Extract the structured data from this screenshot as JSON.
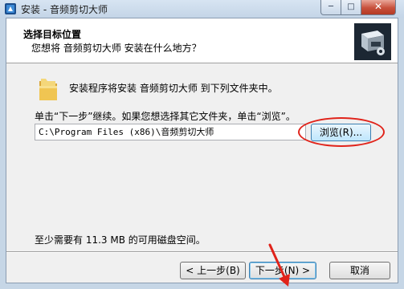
{
  "window": {
    "title": "安装 - 音频剪切大师",
    "minimize_label": "─",
    "maximize_label": "□",
    "close_label": "✕"
  },
  "header": {
    "title": "选择目标位置",
    "subtitle": "您想将 音频剪切大师 安装在什么地方？"
  },
  "body": {
    "destination_message": "安装程序将安装 音频剪切大师 到下列文件夹中。",
    "hint": "单击“下一步”继续。如果您想选择其它文件夹，单击“浏览”。",
    "path_value": "C:\\Program Files (x86)\\音频剪切大师",
    "browse_label": "浏览(R)...",
    "space_required": "至少需要有 11.3 MB 的可用磁盘空间。"
  },
  "footer": {
    "back_label": "< 上一步(B)",
    "next_label": "下一步(N) >",
    "cancel_label": "取消"
  },
  "colors": {
    "annotation": "#e0231a",
    "accent": "#3c7fb1"
  },
  "icons": {
    "app": "app-icon",
    "folder": "folder-icon",
    "logo": "setup-logo-icon"
  }
}
